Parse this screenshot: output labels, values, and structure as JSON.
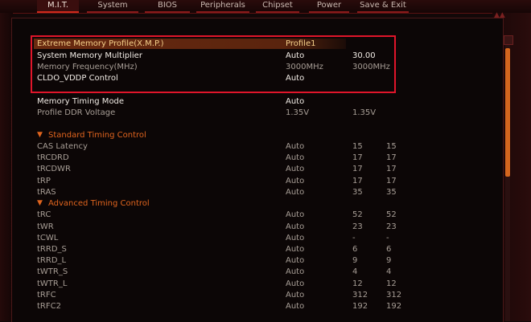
{
  "tabs": [
    "M.I.T.",
    "System",
    "BIOS",
    "Peripherals",
    "Chipset",
    "Power",
    "Save & Exit"
  ],
  "memory_settings": [
    {
      "name": "Extreme Memory Profile(X.M.P.)",
      "value": "Profile1",
      "value2": ""
    },
    {
      "name": "System Memory Multiplier",
      "value": "Auto",
      "value2": "30.00"
    },
    {
      "name": "Memory Frequency(MHz)",
      "value": "3000MHz",
      "value2": "3000MHz"
    },
    {
      "name": "CLDO_VDDP Control",
      "value": "Auto",
      "value2": ""
    },
    {
      "name": "Memory Timing Mode",
      "value": "Auto",
      "value2": ""
    },
    {
      "name": "Profile DDR Voltage",
      "value": "1.35V",
      "value2": "1.35V"
    }
  ],
  "standard_timing": {
    "title": "Standard Timing Control",
    "rows": [
      {
        "name": "CAS Latency",
        "value": "Auto",
        "a": "15",
        "b": "15"
      },
      {
        "name": "tRCDRD",
        "value": "Auto",
        "a": "17",
        "b": "17"
      },
      {
        "name": "tRCDWR",
        "value": "Auto",
        "a": "17",
        "b": "17"
      },
      {
        "name": "tRP",
        "value": "Auto",
        "a": "17",
        "b": "17"
      },
      {
        "name": "tRAS",
        "value": "Auto",
        "a": "35",
        "b": "35"
      }
    ]
  },
  "advanced_timing": {
    "title": "Advanced Timing Control",
    "rows": [
      {
        "name": "tRC",
        "value": "Auto",
        "a": "52",
        "b": "52"
      },
      {
        "name": "tWR",
        "value": "Auto",
        "a": "23",
        "b": "23"
      },
      {
        "name": "tCWL",
        "value": "Auto",
        "a": "-",
        "b": "-"
      },
      {
        "name": "tRRD_S",
        "value": "Auto",
        "a": "6",
        "b": "6"
      },
      {
        "name": "tRRD_L",
        "value": "Auto",
        "a": "9",
        "b": "9"
      },
      {
        "name": "tWTR_S",
        "value": "Auto",
        "a": "4",
        "b": "4"
      },
      {
        "name": "tWTR_L",
        "value": "Auto",
        "a": "12",
        "b": "12"
      },
      {
        "name": "tRFC",
        "value": "Auto",
        "a": "312",
        "b": "312"
      },
      {
        "name": "tRFC2",
        "value": "Auto",
        "a": "192",
        "b": "192"
      }
    ]
  },
  "colors": {
    "accent": "#e0641e",
    "highlight_border": "#e0152a",
    "selected_text": "#f5d08a",
    "scrollbar": "#d4661e"
  },
  "icons": {
    "section_toggle": "triangle-down-icon",
    "scroll_up": "chevron-up-icon"
  }
}
